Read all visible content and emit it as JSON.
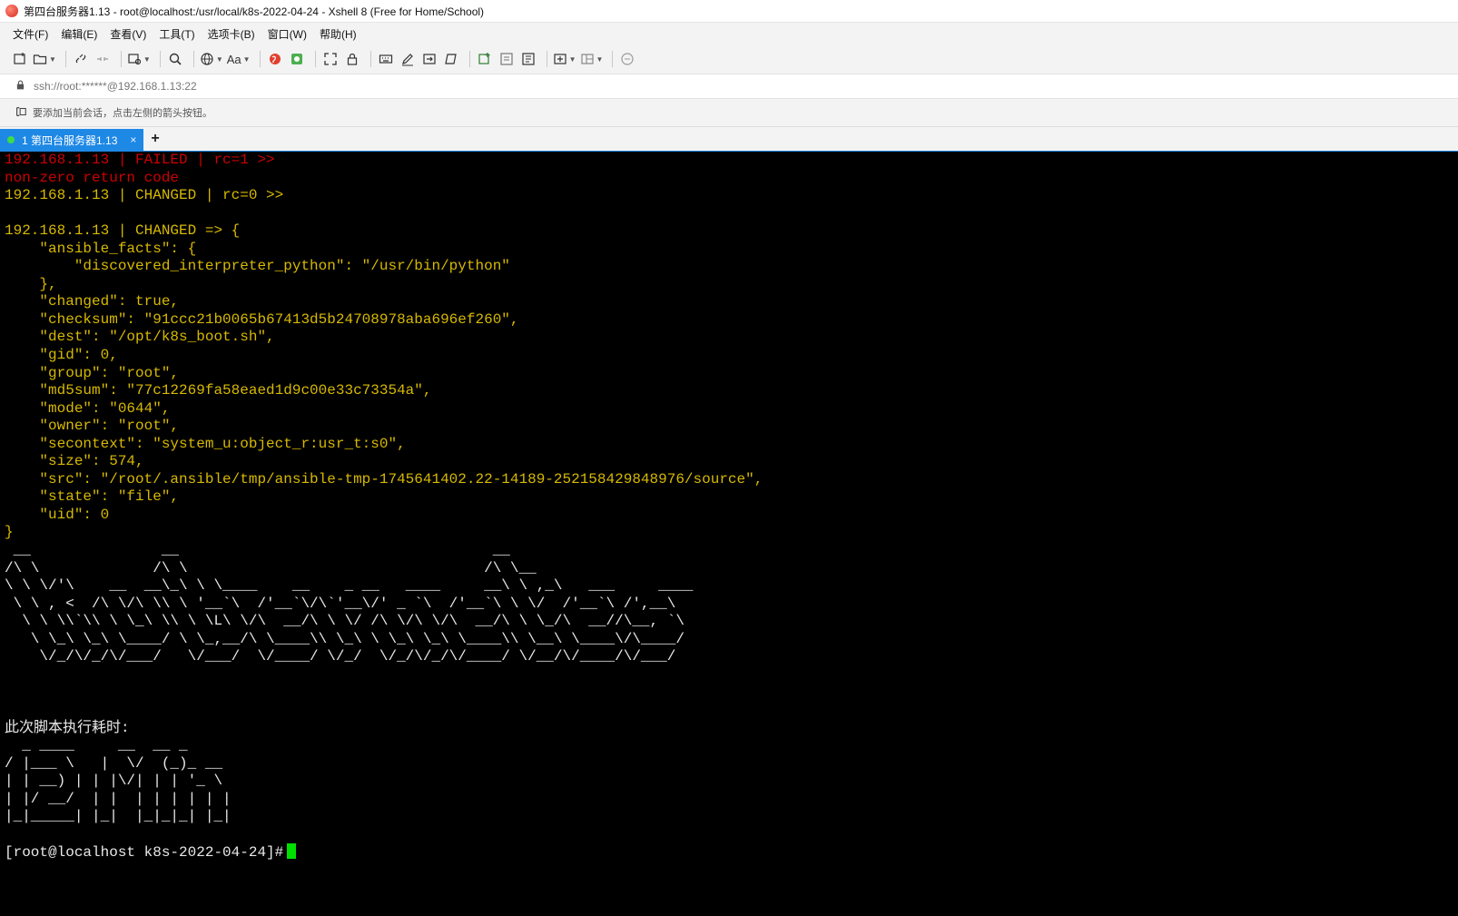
{
  "window": {
    "title": "第四台服务器1.13 - root@localhost:/usr/local/k8s-2022-04-24 - Xshell 8 (Free for Home/School)"
  },
  "menu": [
    "文件(F)",
    "编辑(E)",
    "查看(V)",
    "工具(T)",
    "选项卡(B)",
    "窗口(W)",
    "帮助(H)"
  ],
  "toolbar": {
    "font_label": "Aa"
  },
  "address": {
    "value": "ssh://root:******@192.168.1.13:22"
  },
  "hint": {
    "text": "要添加当前会话，点击左侧的箭头按钮。"
  },
  "tabs": [
    {
      "label": "1 第四台服务器1.13",
      "status_color": "#3ddc4a",
      "close": "×"
    }
  ],
  "tab_add": "+",
  "colors": {
    "accent": "#1e88e5",
    "terminal_bg": "#000000",
    "error": "#cd0000",
    "changed": "#d7b900",
    "cursor": "#00e000"
  },
  "terminal": {
    "lines": [
      {
        "text": "192.168.1.13 | FAILED | rc=1 >>",
        "color": "red"
      },
      {
        "text": "non-zero return code",
        "color": "red"
      },
      {
        "text": "192.168.1.13 | CHANGED | rc=0 >>",
        "color": "yellow"
      },
      {
        "text": "",
        "color": "yellow"
      },
      {
        "text": "192.168.1.13 | CHANGED => {",
        "color": "yellow"
      },
      {
        "text": "    \"ansible_facts\": {",
        "color": "yellow"
      },
      {
        "text": "        \"discovered_interpreter_python\": \"/usr/bin/python\"",
        "color": "yellow"
      },
      {
        "text": "    },",
        "color": "yellow"
      },
      {
        "text": "    \"changed\": true,",
        "color": "yellow"
      },
      {
        "text": "    \"checksum\": \"91ccc21b0065b67413d5b24708978aba696ef260\",",
        "color": "yellow"
      },
      {
        "text": "    \"dest\": \"/opt/k8s_boot.sh\",",
        "color": "yellow"
      },
      {
        "text": "    \"gid\": 0,",
        "color": "yellow"
      },
      {
        "text": "    \"group\": \"root\",",
        "color": "yellow"
      },
      {
        "text": "    \"md5sum\": \"77c12269fa58eaed1d9c00e33c73354a\",",
        "color": "yellow"
      },
      {
        "text": "    \"mode\": \"0644\",",
        "color": "yellow"
      },
      {
        "text": "    \"owner\": \"root\",",
        "color": "yellow"
      },
      {
        "text": "    \"secontext\": \"system_u:object_r:usr_t:s0\",",
        "color": "yellow"
      },
      {
        "text": "    \"size\": 574,",
        "color": "yellow"
      },
      {
        "text": "    \"src\": \"/root/.ansible/tmp/ansible-tmp-1745641402.22-14189-252158429848976/source\",",
        "color": "yellow"
      },
      {
        "text": "    \"state\": \"file\",",
        "color": "yellow"
      },
      {
        "text": "    \"uid\": 0",
        "color": "yellow"
      },
      {
        "text": "}",
        "color": "yellow"
      },
      {
        "text": " __               __                                    __",
        "color": "white"
      },
      {
        "text": "/\\ \\             /\\ \\                                  /\\ \\__",
        "color": "white"
      },
      {
        "text": "\\ \\ \\/'\\    __  __\\_\\ \\ \\____    __    _ __   ____     __\\ \\ ,_\\   ___     ____",
        "color": "white"
      },
      {
        "text": " \\ \\ , <  /\\ \\/\\ \\\\ \\ '__`\\  /'__`\\/\\`'__\\/' _ `\\  /'__`\\ \\ \\/  /'__`\\ /',__\\",
        "color": "white"
      },
      {
        "text": "  \\ \\ \\\\`\\\\ \\ \\_\\ \\\\ \\ \\L\\ \\/\\  __/\\ \\ \\/ /\\ \\/\\ \\/\\  __/\\ \\ \\_/\\  __//\\__, `\\",
        "color": "white"
      },
      {
        "text": "   \\ \\_\\ \\_\\ \\____/ \\ \\_,__/\\ \\____\\\\ \\_\\ \\ \\_\\ \\_\\ \\____\\\\ \\__\\ \\____\\/\\____/",
        "color": "white"
      },
      {
        "text": "    \\/_/\\/_/\\/___/   \\/___/  \\/____/ \\/_/  \\/_/\\/_/\\/____/ \\/__/\\/____/\\/___/",
        "color": "white"
      },
      {
        "text": "",
        "color": "white"
      },
      {
        "text": "",
        "color": "white"
      },
      {
        "text": "",
        "color": "white"
      },
      {
        "text": "此次脚本执行耗时:",
        "color": "white"
      },
      {
        "text": "  _ ____     __  __ _",
        "color": "white"
      },
      {
        "text": "/ |___ \\   |  \\/  (_)_ __",
        "color": "white"
      },
      {
        "text": "| | __) | | |\\/| | | '_ \\",
        "color": "white"
      },
      {
        "text": "| |/ __/  | |  | | | | | |",
        "color": "white"
      },
      {
        "text": "|_|_____| |_|  |_|_|_| |_|",
        "color": "white"
      },
      {
        "text": "",
        "color": "white"
      }
    ],
    "prompt": "[root@localhost k8s-2022-04-24]#"
  }
}
